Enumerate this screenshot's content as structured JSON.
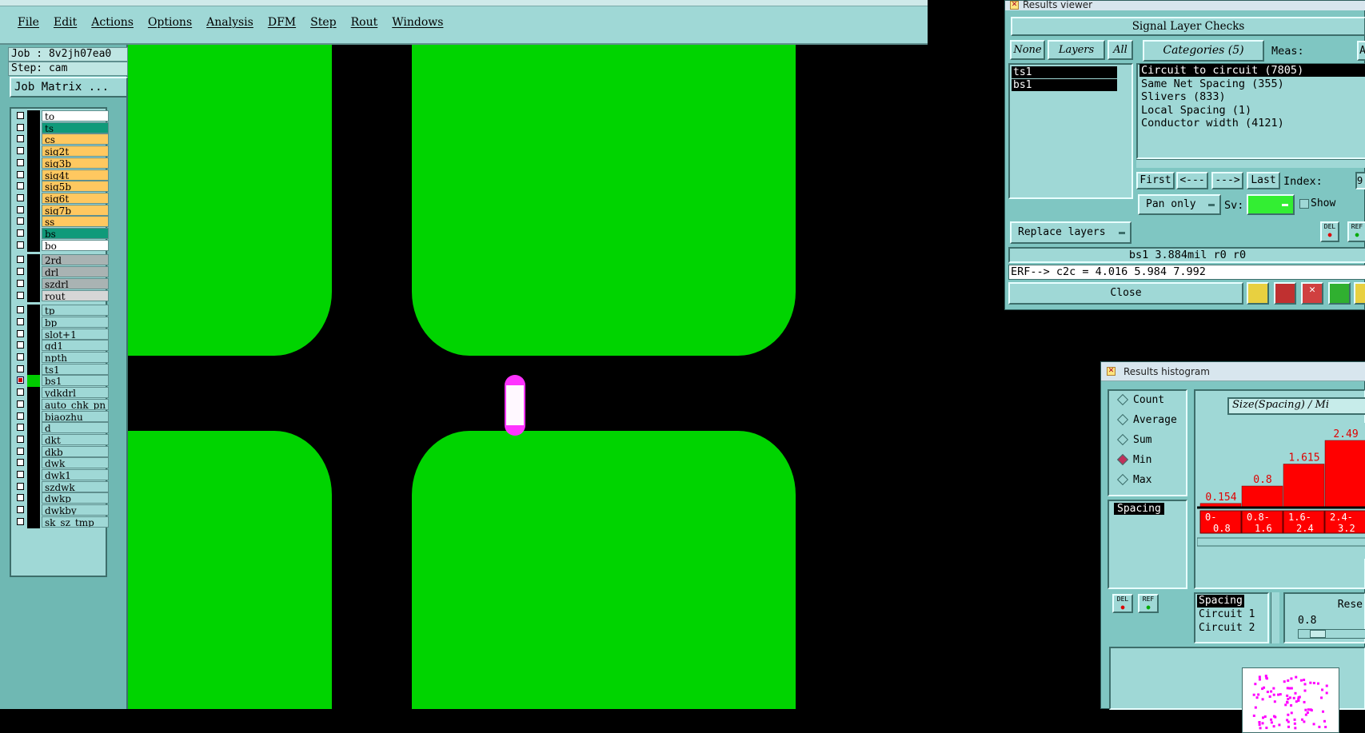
{
  "menu": [
    "File",
    "Edit",
    "Actions",
    "Options",
    "Analysis",
    "DFM",
    "Step",
    "Rout",
    "Windows"
  ],
  "job": {
    "job_label": "Job : 8v2jh07ea0",
    "step_label": "Step: cam",
    "matrix_button": "Job Matrix ..."
  },
  "layers": [
    {
      "name": "to",
      "color": "#ffffff",
      "checked": false,
      "mark": "black"
    },
    {
      "name": "ts",
      "color": "#0f9a7a",
      "checked": false,
      "mark": "black"
    },
    {
      "name": "cs",
      "color": "#ffc860",
      "checked": false,
      "mark": "black"
    },
    {
      "name": "sig2t",
      "color": "#ffc860",
      "checked": false,
      "mark": "black"
    },
    {
      "name": "sig3b",
      "color": "#ffc860",
      "checked": false,
      "mark": "black"
    },
    {
      "name": "sig4t",
      "color": "#ffc860",
      "checked": false,
      "mark": "black"
    },
    {
      "name": "sig5b",
      "color": "#ffc860",
      "checked": false,
      "mark": "black"
    },
    {
      "name": "sig6t",
      "color": "#ffc860",
      "checked": false,
      "mark": "black"
    },
    {
      "name": "sig7b",
      "color": "#ffc860",
      "checked": false,
      "mark": "black"
    },
    {
      "name": "ss",
      "color": "#ffc860",
      "checked": false,
      "mark": "black"
    },
    {
      "name": "bs",
      "color": "#0f9a7a",
      "checked": false,
      "mark": "black"
    },
    {
      "name": "bo",
      "color": "#ffffff",
      "checked": false,
      "mark": "black"
    },
    {
      "name": "2rd",
      "color": "#a9b3b3",
      "checked": false,
      "mark": "black",
      "gap": true
    },
    {
      "name": "drl",
      "color": "#a9b3b3",
      "checked": false,
      "mark": "black"
    },
    {
      "name": "szdrl",
      "color": "#a9b3b3",
      "checked": false,
      "mark": "black"
    },
    {
      "name": "rout",
      "color": "#d6d6d6",
      "checked": false,
      "mark": "black"
    },
    {
      "name": "tp",
      "color": "#9fd8d6",
      "checked": false,
      "mark": "black",
      "gap": true
    },
    {
      "name": "bp",
      "color": "#9fd8d6",
      "checked": false,
      "mark": "black"
    },
    {
      "name": "slot+1",
      "color": "#9fd8d6",
      "checked": false,
      "mark": "black"
    },
    {
      "name": "gd1",
      "color": "#9fd8d6",
      "checked": false,
      "mark": "black"
    },
    {
      "name": "npth",
      "color": "#9fd8d6",
      "checked": false,
      "mark": "black"
    },
    {
      "name": "ts1",
      "color": "#9fd8d6",
      "checked": false,
      "mark": "black"
    },
    {
      "name": "bs1",
      "color": "#9fd8d6",
      "checked": true,
      "mark": "green"
    },
    {
      "name": "ydkdrl",
      "color": "#9fd8d6",
      "checked": false,
      "mark": "black"
    },
    {
      "name": "auto_chk_pn",
      "color": "#9fd8d6",
      "checked": false,
      "mark": "black"
    },
    {
      "name": "biaozhu",
      "color": "#9fd8d6",
      "checked": false,
      "mark": "black"
    },
    {
      "name": "d",
      "color": "#9fd8d6",
      "checked": false,
      "mark": "black"
    },
    {
      "name": "dkt",
      "color": "#9fd8d6",
      "checked": false,
      "mark": "black"
    },
    {
      "name": "dkb",
      "color": "#9fd8d6",
      "checked": false,
      "mark": "black"
    },
    {
      "name": "dwk",
      "color": "#9fd8d6",
      "checked": false,
      "mark": "black"
    },
    {
      "name": "dwk1",
      "color": "#9fd8d6",
      "checked": false,
      "mark": "black"
    },
    {
      "name": "szdwk",
      "color": "#9fd8d6",
      "checked": false,
      "mark": "black"
    },
    {
      "name": "dwkp",
      "color": "#9fd8d6",
      "checked": false,
      "mark": "black"
    },
    {
      "name": "dwkby",
      "color": "#9fd8d6",
      "checked": false,
      "mark": "black"
    },
    {
      "name": "sk_sz_tmp",
      "color": "#9fd8d6",
      "checked": false,
      "mark": "black"
    }
  ],
  "results_viewer": {
    "window_title": "Results viewer",
    "heading": "Signal Layer Checks",
    "none_btn": "None",
    "layers_btn": "Layers",
    "all_btn": "All",
    "categories_btn": "Categories (5)",
    "meas_label": "Meas:",
    "meas_value": "A",
    "layer_items": [
      "ts1",
      "bs1"
    ],
    "categories": [
      "Circuit to circuit (7805)",
      "Same Net Spacing (355)",
      "Slivers (833)",
      "Local Spacing (1)",
      "Conductor width (4121)"
    ],
    "first_btn": "First",
    "prev_btn": "<---",
    "next_btn": "--->",
    "last_btn": "Last",
    "index_label": "Index:",
    "index_value": "9",
    "pan_only": "Pan only",
    "sv_label": "Sv:",
    "show_label": "Show",
    "replace_layers": "Replace layers",
    "del_label": "DEL",
    "ref_label": "REF",
    "status_line": "bs1 3.884mil  r0  r0",
    "erf_line": "ERF--> c2c = 4.016 5.984 7.992",
    "close_btn": "Close"
  },
  "results_histogram": {
    "window_title": "Results histogram",
    "radios": [
      {
        "label": "Count",
        "on": false
      },
      {
        "label": "Average",
        "on": false
      },
      {
        "label": "Sum",
        "on": false
      },
      {
        "label": "Min",
        "on": true
      },
      {
        "label": "Max",
        "on": false
      }
    ],
    "list_item": "Spacing",
    "chart_title": "Size(Spacing) / Mi",
    "del_label": "DEL",
    "ref_label": "REF",
    "bottom_list": [
      "Spacing",
      "Circuit 1",
      "Circuit 2"
    ],
    "res_label": "Rese",
    "slider_value": "0.8",
    "chart_data": {
      "type": "bar",
      "title": "Size(Spacing) / Mi",
      "categories": [
        "0-\n0.8",
        "0.8-\n1.6",
        "1.6-\n2.4",
        "2.4-\n3.2"
      ],
      "values": [
        0.154,
        0.8,
        1.615,
        2.49
      ],
      "value_labels": [
        "0.154",
        "0.8",
        "1.615",
        "2.49"
      ],
      "color": "#ff0000"
    }
  },
  "colors": {
    "panel": "#9fd8d6",
    "copper": "#00d400",
    "highlight": "#ff33ff"
  }
}
